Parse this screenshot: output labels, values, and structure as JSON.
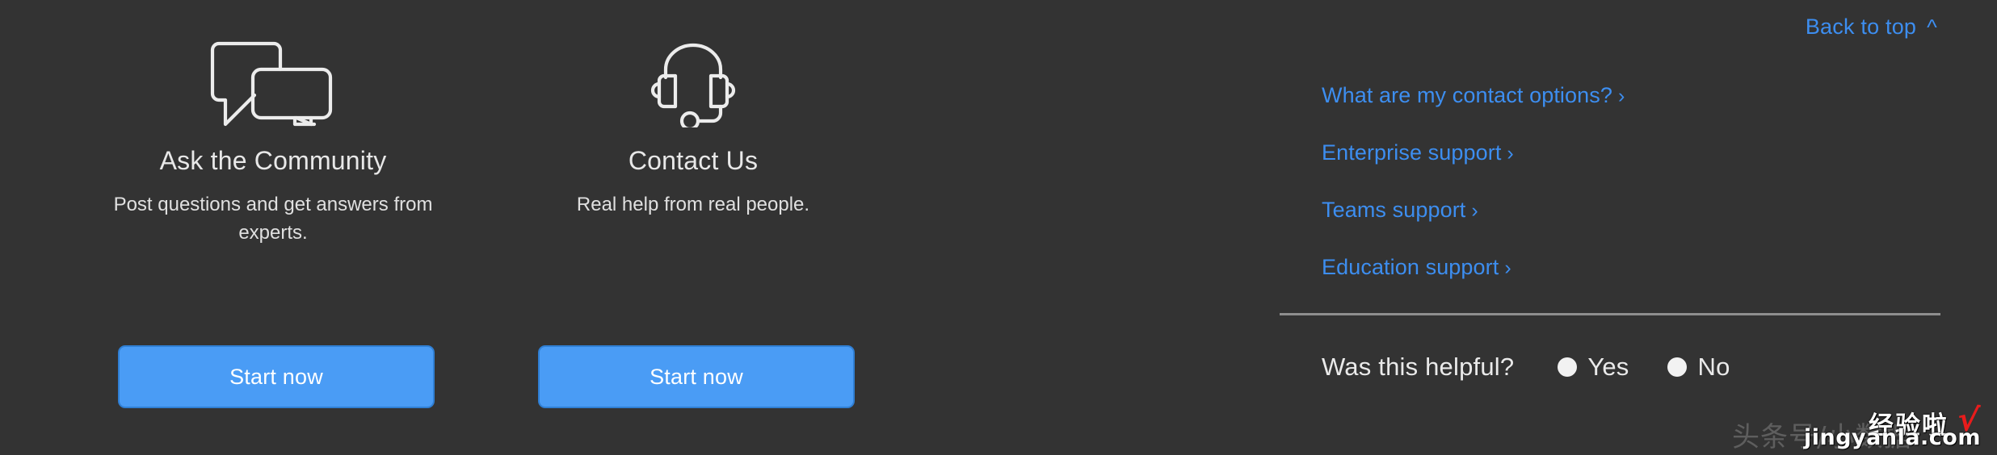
{
  "theme": {
    "background": "#333333",
    "link_color": "#3d8ef0",
    "button_color": "#4a9cf5",
    "text_color": "#e8e8e8",
    "divider_color": "#8e8e8e"
  },
  "back_to_top": {
    "label": "Back to top",
    "caret": "^"
  },
  "cards": [
    {
      "icon": "chat-bubbles-icon",
      "title": "Ask the Community",
      "description": "Post questions and get answers from experts.",
      "button_label": "Start now"
    },
    {
      "icon": "headset-icon",
      "title": "Contact Us",
      "description": "Real help from real people.",
      "button_label": "Start now"
    }
  ],
  "support_links": [
    {
      "label": "What are my contact options?",
      "chevron": "›"
    },
    {
      "label": "Enterprise support",
      "chevron": "›"
    },
    {
      "label": "Teams support",
      "chevron": "›"
    },
    {
      "label": "Education support",
      "chevron": "›"
    }
  ],
  "feedback": {
    "question": "Was this helpful?",
    "options": [
      {
        "label": "Yes"
      },
      {
        "label": "No"
      }
    ]
  },
  "watermark": {
    "ghost_text": "头条号/小数据",
    "brand_cn": "经验啦",
    "check": "√",
    "url": "jingyanla.com"
  }
}
